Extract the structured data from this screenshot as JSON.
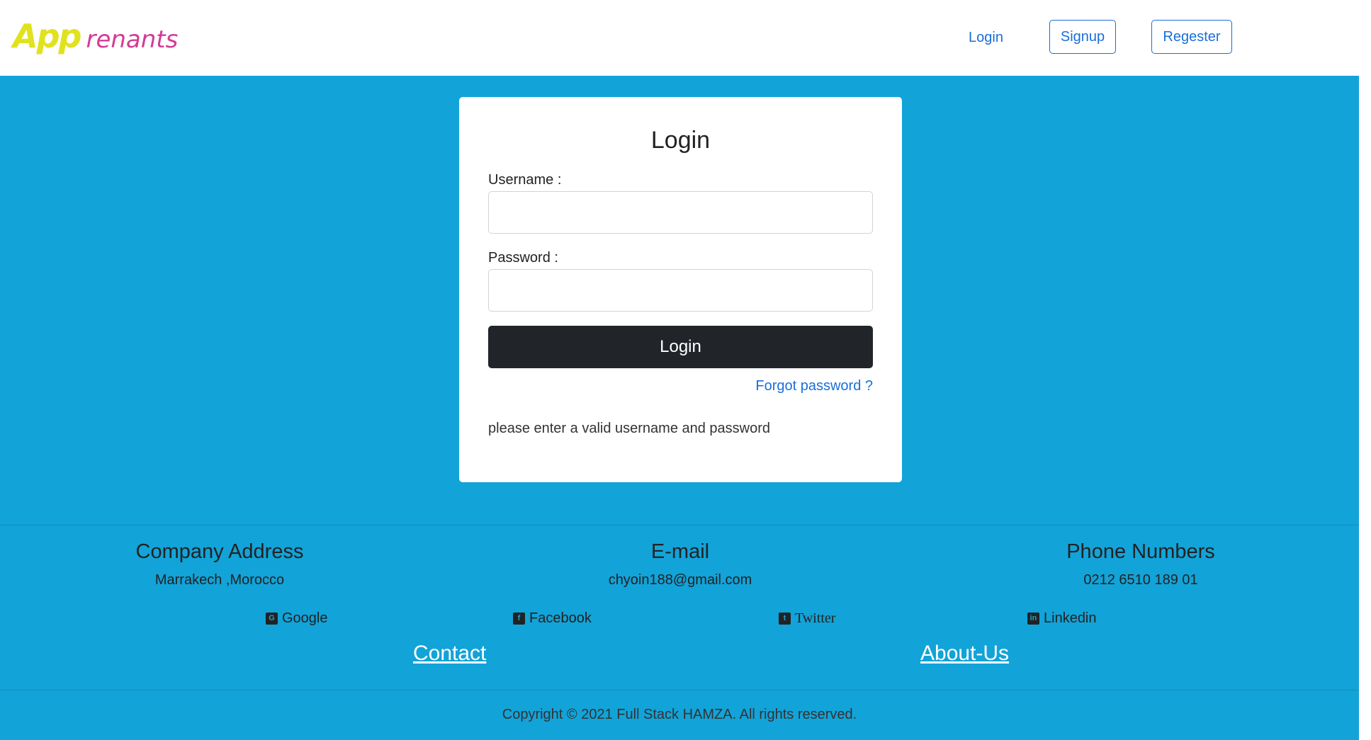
{
  "header": {
    "logo_app": "App",
    "logo_renants": "renants",
    "login_link": "Login",
    "signup_button": "Signup",
    "register_button": "Regester"
  },
  "login_card": {
    "title": "Login",
    "username_label": "Username :",
    "username_value": "",
    "password_label": "Password :",
    "password_value": "",
    "submit_label": "Login",
    "forgot_password": "Forgot password ?",
    "error_message": "please enter a valid username and password"
  },
  "footer": {
    "address_heading": "Company Address",
    "address_value": "Marrakech ,Morocco",
    "email_heading": "E-mail",
    "email_value": "chyoin188@gmail.com",
    "phone_heading": "Phone Numbers",
    "phone_value": "0212 6510 189 01",
    "social": {
      "google": "Google",
      "facebook": "Facebook",
      "twitter": "Twitter",
      "linkedin": "Linkedin"
    },
    "contact_link": "Contact",
    "about_link": "About-Us",
    "copyright": "Copyright © 2021 Full Stack HAMZA. All rights reserved."
  },
  "colors": {
    "background": "#12a3d8",
    "logo_app": "#e1e21e",
    "logo_renants": "#d43b97",
    "link": "#1a6ed8",
    "button_dark": "#212529"
  }
}
